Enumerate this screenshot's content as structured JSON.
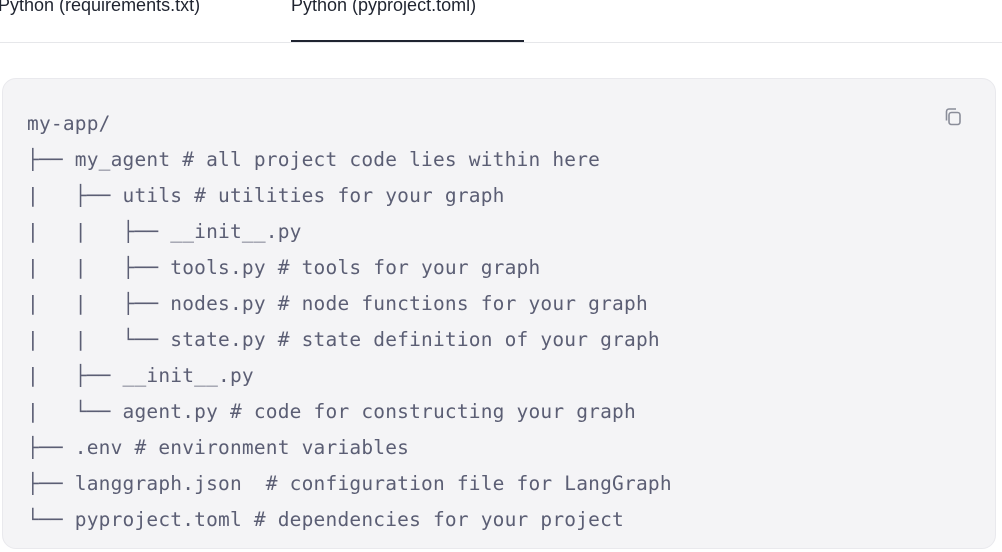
{
  "tabs": [
    {
      "label": "Python (requirements.txt)",
      "active": false
    },
    {
      "label": "Python (pyproject.toml)",
      "active": true
    }
  ],
  "code_block": {
    "copy_icon": "copy-icon",
    "lines": [
      "my-app/",
      "├── my_agent # all project code lies within here",
      "|   ├── utils # utilities for your graph",
      "|   |   ├── __init__.py",
      "|   |   ├── tools.py # tools for your graph",
      "|   |   ├── nodes.py # node functions for your graph",
      "|   |   └── state.py # state definition of your graph",
      "|   ├── __init__.py",
      "|   └── agent.py # code for constructing your graph",
      "├── .env # environment variables",
      "├── langgraph.json  # configuration file for LangGraph",
      "└── pyproject.toml # dependencies for your project"
    ]
  },
  "colors": {
    "code_background": "#f4f4f6",
    "code_text": "#5b5e74",
    "tab_text": "#1f2430",
    "divider": "#e6e7ea"
  }
}
